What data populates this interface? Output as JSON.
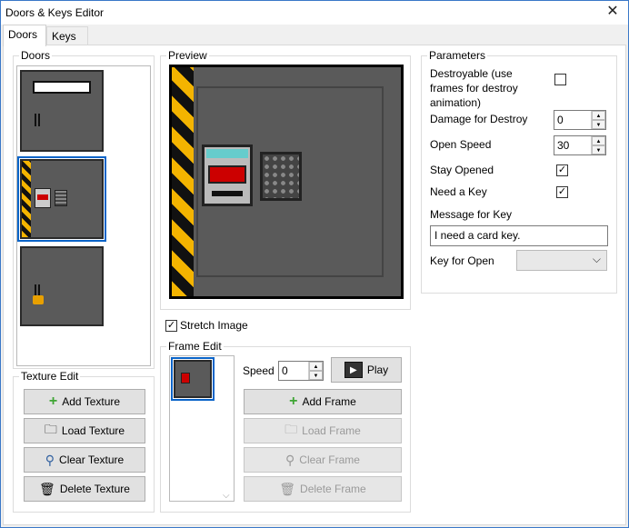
{
  "window": {
    "title": "Doors & Keys Editor",
    "close": "✕"
  },
  "tabs": [
    {
      "label": "Doors"
    },
    {
      "label": "Keys"
    }
  ],
  "doors_group": {
    "label": "Doors"
  },
  "texture_edit": {
    "label": "Texture Edit",
    "add_label": "Add Texture",
    "load_label": "Load Texture",
    "clear_label": "Clear Texture",
    "delete_label": "Delete Texture"
  },
  "preview": {
    "label": "Preview",
    "stretch_label": "Stretch Image",
    "stretch_checked": "✓"
  },
  "frame_edit": {
    "label": "Frame Edit",
    "speed_label": "Speed",
    "speed_value": "0",
    "play_label": "Play",
    "add_label": "Add Frame",
    "load_label": "Load Frame",
    "clear_label": "Clear Frame",
    "delete_label": "Delete Frame"
  },
  "parameters": {
    "label": "Parameters",
    "destroyable_label": "Destroyable (use frames for destroy animation)",
    "damage_label": "Damage for Destroy",
    "damage_value": "0",
    "open_speed_label": "Open Speed",
    "open_speed_value": "30",
    "stay_opened_label": "Stay Opened",
    "stay_opened_check": "✓",
    "need_key_label": "Need a Key",
    "need_key_check": "✓",
    "message_label": "Message for Key",
    "message_value": "I need a card key.",
    "key_open_label": "Key for Open"
  },
  "colors": {
    "accent": "#0a64c8",
    "hazard_yellow": "#f4b400",
    "door_gray": "#5a5a5a"
  }
}
